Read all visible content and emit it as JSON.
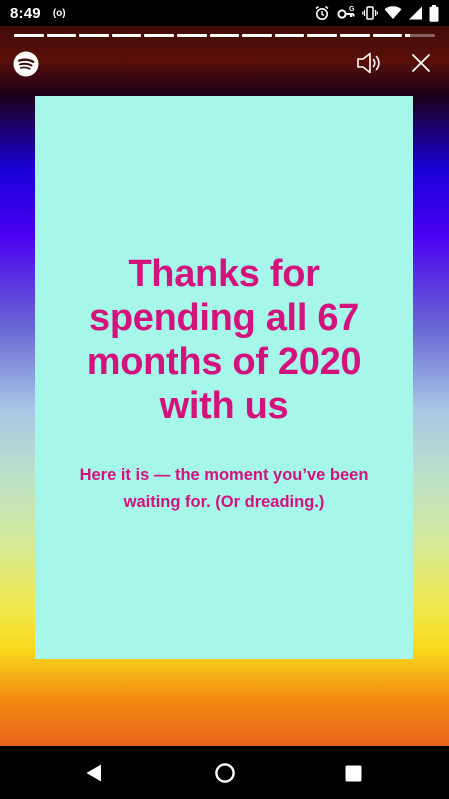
{
  "status_bar": {
    "time": "8:49",
    "radio_indicator": "(o)",
    "icons": [
      "alarm-icon",
      "vpn-key-icon",
      "vibrate-icon",
      "wifi-icon",
      "signal-icon",
      "battery-icon"
    ]
  },
  "story": {
    "segments_total": 13,
    "segments_completed": 12,
    "current_segment_progress": 0.15
  },
  "header": {
    "logo": "spotify-icon",
    "volume_icon": "volume-icon",
    "close_icon": "close-icon"
  },
  "card": {
    "title": "Thanks for spending all 67 months of 2020 with us",
    "subtitle": "Here it is — the moment you’ve been waiting for. (Or dreading.)",
    "background": "#a6f6ea",
    "text_color": "#d4127c"
  },
  "nav_bar": {
    "icons": [
      "back-icon",
      "home-icon",
      "recents-icon"
    ]
  }
}
